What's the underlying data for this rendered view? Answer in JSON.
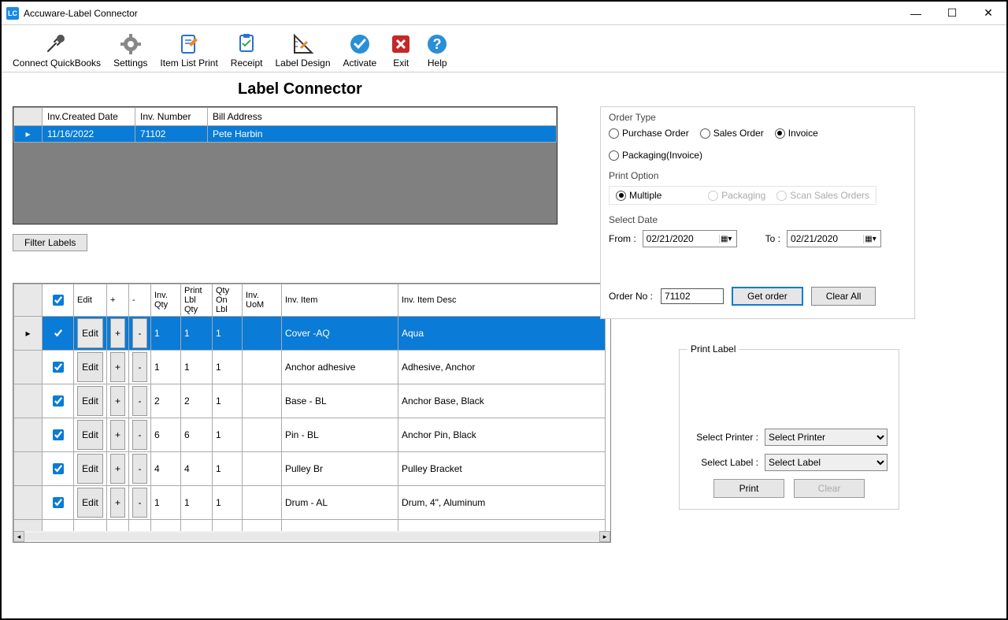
{
  "window": {
    "title": "Accuware-Label Connector",
    "logo_text": "LC"
  },
  "toolbar": {
    "connect": "Connect QuickBooks",
    "settings": "Settings",
    "itemlist": "Item List Print",
    "receipt": "Receipt",
    "labeldesign": "Label Design",
    "activate": "Activate",
    "exit": "Exit",
    "help": "Help"
  },
  "heading": "Label Connector",
  "invgrid": {
    "headers": {
      "date": "Inv.Created Date",
      "num": "Inv. Number",
      "addr": "Bill Address"
    },
    "rows": [
      {
        "date": "11/16/2022",
        "num": "71102",
        "addr": "Pete Harbin"
      }
    ]
  },
  "filter_button": "Filter Labels",
  "linegrid": {
    "headers": {
      "edit": "Edit",
      "plus": "+",
      "minus": "-",
      "invqty": "Inv. Qty",
      "printlblqty": "Print Lbl Qty",
      "qtyonlbl": "Qty On Lbl",
      "invuom": "Inv. UoM",
      "invitem": "Inv. Item",
      "invitemdesc": "Inv. Item Desc"
    },
    "buttons": {
      "edit": "Edit",
      "plus": "+",
      "minus": "-"
    },
    "rows": [
      {
        "sel": true,
        "invqty": "1",
        "printlblqty": "1",
        "qtyonlbl": "1",
        "invuom": "",
        "item": "Cover -AQ",
        "desc": "Aqua"
      },
      {
        "sel": false,
        "invqty": "1",
        "printlblqty": "1",
        "qtyonlbl": "1",
        "invuom": "",
        "item": "Anchor adhesive",
        "desc": "Adhesive, Anchor"
      },
      {
        "sel": false,
        "invqty": "2",
        "printlblqty": "2",
        "qtyonlbl": "1",
        "invuom": "",
        "item": "Base - BL",
        "desc": "Anchor Base, Black"
      },
      {
        "sel": false,
        "invqty": "6",
        "printlblqty": "6",
        "qtyonlbl": "1",
        "invuom": "",
        "item": "Pin - BL",
        "desc": "Anchor Pin, Black"
      },
      {
        "sel": false,
        "invqty": "4",
        "printlblqty": "4",
        "qtyonlbl": "1",
        "invuom": "",
        "item": "Pulley Br",
        "desc": "Pulley Bracket"
      },
      {
        "sel": false,
        "invqty": "1",
        "printlblqty": "1",
        "qtyonlbl": "1",
        "invuom": "",
        "item": "Drum - AL",
        "desc": "Drum, 4\", Aluminum"
      }
    ]
  },
  "right": {
    "ordertype": {
      "label": "Order Type",
      "po": "Purchase Order",
      "so": "Sales Order",
      "inv": "Invoice",
      "pkg": "Packaging(Invoice)",
      "selected": "inv"
    },
    "printoption": {
      "label": "Print Option",
      "multiple": "Multiple",
      "packaging": "Packaging",
      "scan": "Scan Sales Orders",
      "selected": "multiple"
    },
    "selectdate": {
      "label": "Select Date",
      "from_lbl": "From :",
      "to_lbl": "To :",
      "from": "02/21/2020",
      "to": "02/21/2020"
    },
    "orderno": {
      "label": "Order No :",
      "value": "71102",
      "getorder": "Get order",
      "clearall": "Clear All"
    }
  },
  "printlabel": {
    "legend": "Print Label",
    "printer_lbl": "Select Printer :",
    "printer_ph": "Select Printer",
    "label_lbl": "Select Label :",
    "label_ph": "Select Label",
    "print": "Print",
    "clear": "Clear"
  }
}
